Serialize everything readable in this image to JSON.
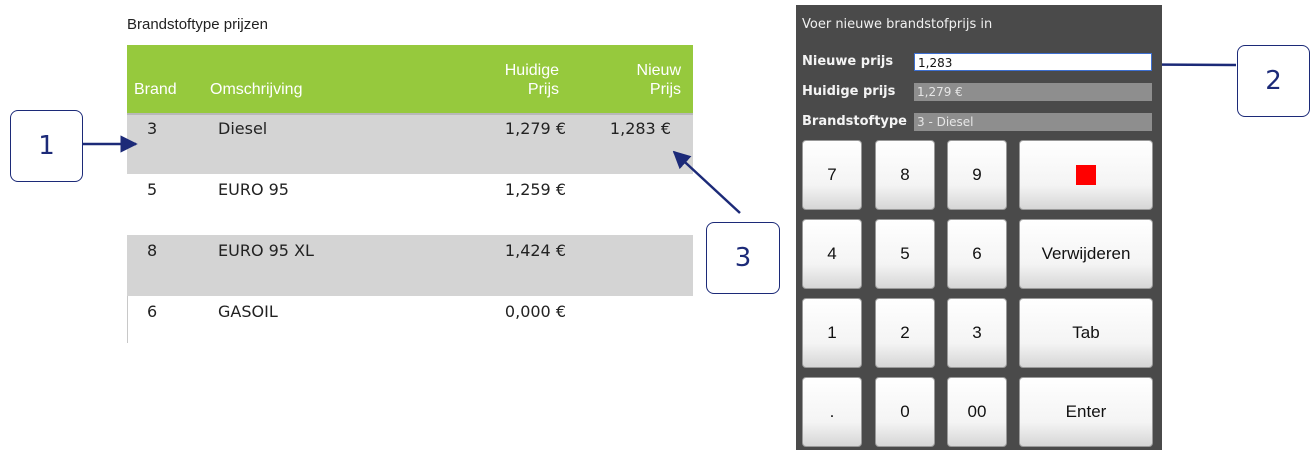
{
  "price_table": {
    "title": "Brandstoftype prijzen",
    "headers": {
      "brand": "Brand",
      "description": "Omschrijving",
      "current_price": [
        "Huidige",
        "Prijs"
      ],
      "new_price": [
        "Nieuw",
        "Prijs"
      ]
    },
    "rows": [
      {
        "brand": "3",
        "description": "Diesel",
        "current": "1,279 €",
        "new": "1,283 €",
        "selected": true
      },
      {
        "brand": "5",
        "description": "EURO 95",
        "current": "1,259 €",
        "new": ""
      },
      {
        "brand": "8",
        "description": "EURO 95 XL",
        "current": "1,424 €",
        "new": ""
      },
      {
        "brand": "6",
        "description": "GASOIL",
        "current": "0,000 €",
        "new": ""
      }
    ],
    "header_color": "#96c93d",
    "shaded_row_color": "#d4d4d4"
  },
  "keypad_panel": {
    "title": "Voer nieuwe brandstofprijs in",
    "fields": {
      "new_price_label": "Nieuwe prijs",
      "new_price_value": "1,283",
      "current_price_label": "Huidige prijs",
      "current_price_value": "1,279 €",
      "fuel_type_label": "Brandstoftype",
      "fuel_type_value": "3 - Diesel"
    },
    "keys": {
      "k7": "7",
      "k8": "8",
      "k9": "9",
      "k4": "4",
      "k5": "5",
      "k6": "6",
      "k1": "1",
      "k2": "2",
      "k3": "3",
      "dot": ".",
      "k0": "0",
      "k00": "00",
      "delete": "Verwijderen",
      "tab": "Tab",
      "enter": "Enter",
      "stop_icon": "red-square-icon"
    },
    "panel_color": "#4a4a4a"
  },
  "callouts": {
    "one": "1",
    "two": "2",
    "three": "3",
    "color": "#1c2a78"
  }
}
